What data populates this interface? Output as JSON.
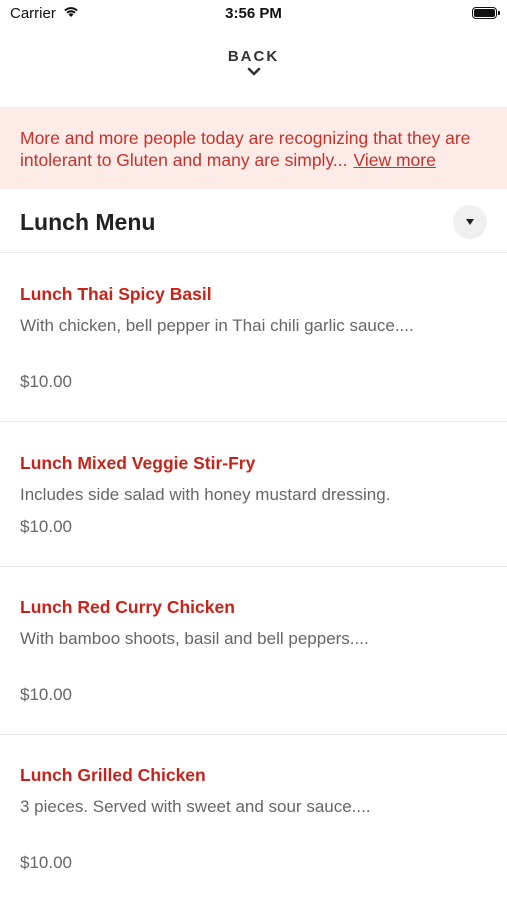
{
  "status": {
    "carrier": "Carrier",
    "time": "3:56 PM"
  },
  "back": {
    "label": "BACK"
  },
  "notice": {
    "text": "More and more people today are recognizing that they are intolerant to Gluten and many are simply...",
    "link": "View more"
  },
  "menu": {
    "title": "Lunch Menu"
  },
  "items": [
    {
      "name": "Lunch Thai Spicy Basil",
      "desc": "With chicken, bell pepper in Thai chili garlic sauce....",
      "price": "$10.00"
    },
    {
      "name": "Lunch Mixed Veggie Stir-Fry",
      "desc": "Includes side salad with honey mustard dressing.",
      "price": "$10.00"
    },
    {
      "name": "Lunch Red Curry Chicken",
      "desc": "With bamboo shoots, basil and bell peppers....",
      "price": "$10.00"
    },
    {
      "name": "Lunch Grilled Chicken",
      "desc": "3 pieces. Served with sweet and sour sauce....",
      "price": "$10.00"
    }
  ],
  "colors": {
    "accent": "#c8231a",
    "notice_bg": "#fdebe8"
  }
}
